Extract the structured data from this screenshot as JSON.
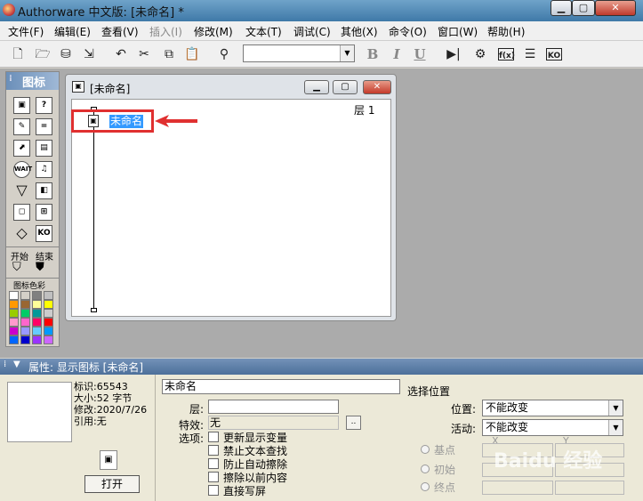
{
  "window": {
    "title": "Authorware 中文版: [未命名] *"
  },
  "menubar": [
    "文件(F)",
    "编辑(E)",
    "查看(V)",
    "插入(I)",
    "修改(M)",
    "文本(T)",
    "调试(C)",
    "其他(X)",
    "命令(O)",
    "窗口(W)",
    "帮助(H)"
  ],
  "toolbar": {
    "icons": [
      "new-icon",
      "open-icon",
      "save-all-icon",
      "import-icon",
      "undo-icon",
      "cut-icon",
      "copy-icon",
      "paste-icon",
      "find-icon"
    ],
    "bold": "B",
    "italic": "I",
    "underline": "U",
    "font_combo_value": "",
    "right_icons": [
      "restart-icon",
      "control-panel-icon",
      "functions-icon",
      "variables-icon",
      "knowledge-objects-icon"
    ],
    "fn_label": "f(x)",
    "ko_label": "KO"
  },
  "palette": {
    "title": "图标",
    "start_label": "开始",
    "end_label": "结束",
    "colors_label": "图标色彩",
    "icons": [
      "display-icon",
      "motion-icon",
      "erase-icon",
      "wait-icon",
      "navigate-icon",
      "framework-icon",
      "decision-icon",
      "interaction-icon",
      "calculation-icon",
      "map-icon",
      "digital-movie-icon",
      "sound-icon",
      "video-icon",
      "knowledge-object-icon"
    ],
    "wait_text": "WAIT",
    "ko_text": "KO",
    "swatches": [
      "#ffffff",
      "#d4d0c8",
      "#808080",
      "#c0c0c0",
      "#ff9900",
      "#996633",
      "#ffff99",
      "#ffff00",
      "#99cc00",
      "#00cc66",
      "#009999",
      "#cccccc",
      "#ff99cc",
      "#ff66cc",
      "#ff0066",
      "#ff0000",
      "#cc00cc",
      "#9999ff",
      "#66ccff",
      "#0099ff",
      "#0066ff",
      "#0000cc",
      "#9933ff",
      "#cc66ff"
    ]
  },
  "flow_window": {
    "title": "[未命名]",
    "level_label": "层 1",
    "icon_name": "未命名",
    "highlight_color": "#e03030"
  },
  "properties": {
    "title": "属性: 显示图标 [未命名]",
    "id_label": "标识:",
    "id_value": "65543",
    "size_label": "大小:",
    "size_value": "52 字节",
    "modified_label": "修改:",
    "modified_value": "2020/7/26",
    "ref_label": "引用:",
    "ref_value": "无",
    "open_button": "打开",
    "name_value": "未命名",
    "layer_label": "层:",
    "layer_value": "",
    "effect_label": "特效:",
    "effect_value": "无",
    "effect_button": "..",
    "options_label": "选项:",
    "options": [
      "更新显示变量",
      "禁止文本查找",
      "防止自动擦除",
      "擦除以前内容",
      "直接写屏"
    ],
    "position_group": "选择位置",
    "position_label": "位置:",
    "position_value": "不能改变",
    "active_label": "活动:",
    "active_value": "不能改变",
    "base_label": "基点",
    "initial_label": "初始",
    "end_label": "终点",
    "x_label": "X",
    "y_label": "Y"
  },
  "watermark": "Baidu 经验"
}
